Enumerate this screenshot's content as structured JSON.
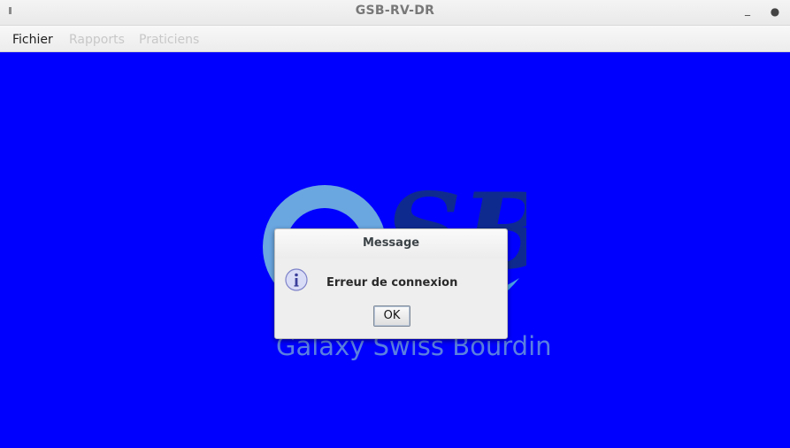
{
  "window": {
    "title": "GSB-RV-DR"
  },
  "menubar": {
    "items": [
      "Fichier",
      "Rapports",
      "Praticiens"
    ]
  },
  "logo": {
    "tagline": "Galaxy Swiss Bourdin",
    "letters": "SB"
  },
  "dialog": {
    "title": "Message",
    "message": "Erreur de connexion",
    "ok_label": "OK"
  },
  "colors": {
    "background": "#0000ff",
    "dialog_bg": "#eeeeee"
  },
  "icons": {
    "dialog_icon": "information-icon"
  }
}
